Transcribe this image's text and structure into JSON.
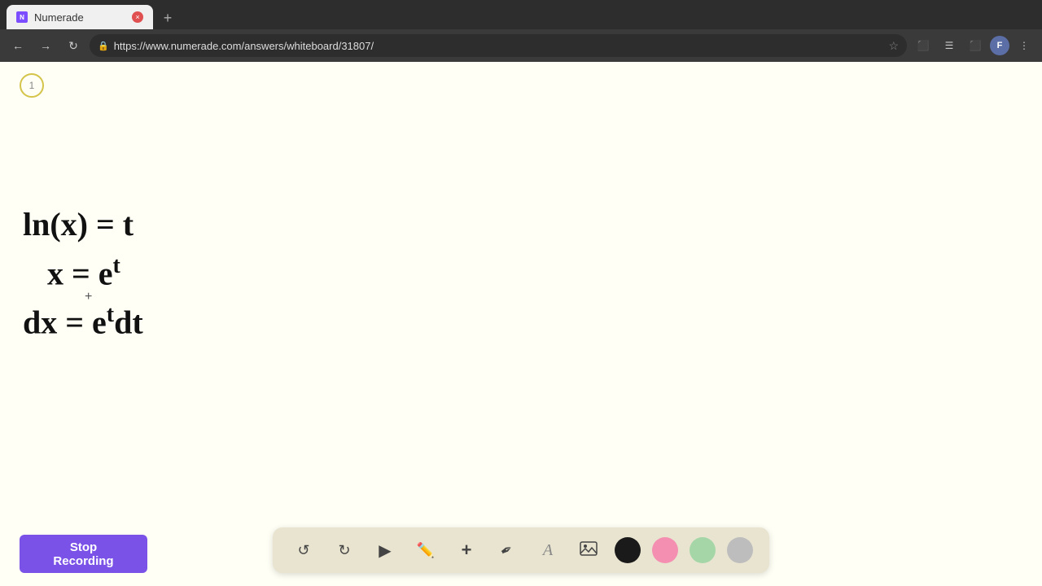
{
  "browser": {
    "tab_title": "Numerade",
    "tab_favicon": "N",
    "url": "https://www.numerade.com/answers/whiteboard/31807/",
    "tab_close_label": "×",
    "tab_new_label": "+"
  },
  "nav": {
    "back_icon": "←",
    "forward_icon": "→",
    "refresh_icon": "↻",
    "lock_icon": "🔒",
    "star_icon": "★",
    "cast_icon": "⬛",
    "bookmark_icon": "☰",
    "extensions_icon": "🧩",
    "user_initial": "F",
    "menu_icon": "⋮"
  },
  "page_indicator": "1",
  "math_lines": [
    "ln(x) = t",
    "  x = e",
    "dx = e dt"
  ],
  "stop_recording_label": "Stop Recording",
  "toolbar": {
    "undo_icon": "↺",
    "redo_icon": "↻",
    "select_icon": "▷",
    "pen_icon": "✏",
    "add_icon": "+",
    "eraser_icon": "/",
    "text_icon": "A",
    "image_icon": "🖼",
    "colors": [
      "#1a1a1a",
      "#f48fb1",
      "#a5d6a7",
      "#bdbdbd"
    ]
  }
}
